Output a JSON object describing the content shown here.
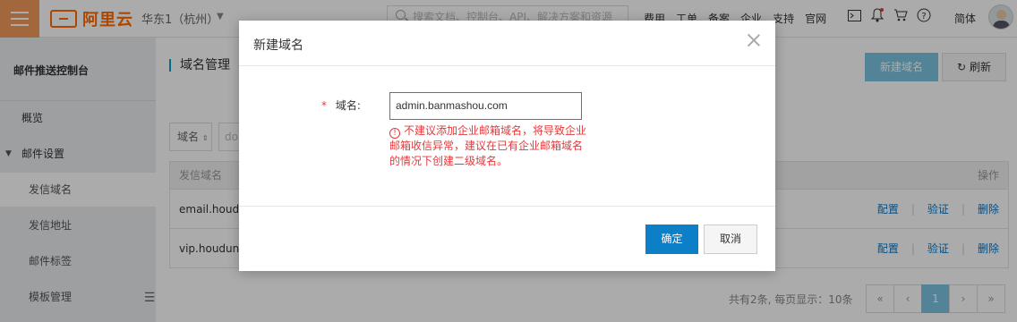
{
  "topbar": {
    "logo_text": "阿里云",
    "region": "华东1（杭州）",
    "search_placeholder": "搜索文档、控制台、API、解决方案和资源",
    "nav": [
      "费用",
      "工单",
      "备案",
      "企业",
      "支持",
      "官网"
    ],
    "lang": "简体"
  },
  "sidebar": {
    "title": "邮件推送控制台",
    "items": [
      {
        "label": "概览"
      },
      {
        "label": "邮件设置"
      },
      {
        "label": "发信域名"
      },
      {
        "label": "发信地址"
      },
      {
        "label": "邮件标签"
      },
      {
        "label": "模板管理"
      }
    ]
  },
  "main": {
    "title": "域名管理",
    "new_button": "新建域名",
    "refresh_button": "刷新",
    "filter_select": "域名",
    "filter_input": "do",
    "table": {
      "headers": {
        "domain": "发信域名",
        "ops": "操作"
      },
      "rows": [
        {
          "domain": "email.houdun"
        },
        {
          "domain": "vip.houdunre"
        }
      ],
      "ops": {
        "config": "配置",
        "verify": "验证",
        "delete": "删除"
      }
    },
    "pager_info": "共有2条, 每页显示：10条",
    "pager": {
      "first": "«",
      "prev": "‹",
      "current": "1",
      "next": "›",
      "last": "»"
    }
  },
  "modal": {
    "title": "新建域名",
    "required_mark": "*",
    "field_label": "域名:",
    "field_value": "admin.banmashou.com",
    "warning": "不建议添加企业邮箱域名，将导致企业邮箱收信异常，建议在已有企业邮箱域名的情况下创建二级域名。",
    "ok_button": "确定",
    "cancel_button": "取消"
  },
  "colors": {
    "brand": "#ff6a00",
    "primary": "#0d7fc6",
    "link": "#0077cc",
    "error": "#e4393c",
    "input_focus": "#36a300"
  },
  "icons": [
    "hamburger-icon",
    "search-icon",
    "terminal-icon",
    "bell-icon",
    "cart-icon",
    "help-icon",
    "refresh-icon",
    "close-icon",
    "warning-icon"
  ]
}
